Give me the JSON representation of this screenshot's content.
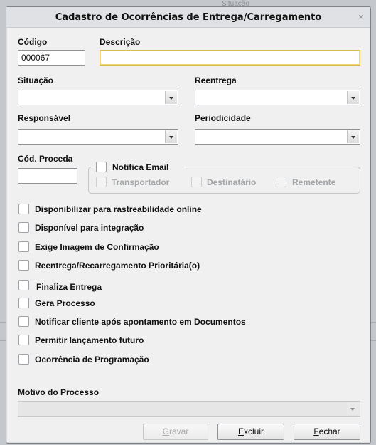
{
  "background": {
    "header_fragment": "Situação"
  },
  "dialog": {
    "title": "Cadastro de Ocorrências de Entrega/Carregamento"
  },
  "fields": {
    "codigo_label": "Código",
    "codigo_value": "000067",
    "descricao_label": "Descrição",
    "descricao_value": "",
    "situacao_label": "Situação",
    "situacao_value": "",
    "reentrega_label": "Reentrega",
    "reentrega_value": "",
    "responsavel_label": "Responsável",
    "responsavel_value": "",
    "periodicidade_label": "Periodicidade",
    "periodicidade_value": "",
    "cod_proceda_label": "Cód. Proceda",
    "cod_proceda_value": "",
    "motivo_label": "Motivo do Processo",
    "motivo_value": ""
  },
  "notifica": {
    "label": "Notifica Email",
    "options": [
      "Transportador",
      "Destinatário",
      "Remetente"
    ]
  },
  "checkboxes": [
    "Disponibilizar para rastreabilidade online",
    "Disponível para integração",
    "Exige Imagem de Confirmação",
    "Reentrega/Recarregamento Prioritária(o)",
    "Finaliza Entrega",
    "Gera Processo",
    "Notificar cliente após apontamento em Documentos",
    "Permitir lançamento futuro",
    "Ocorrência de Programação"
  ],
  "buttons": {
    "gravar": {
      "key": "G",
      "rest": "ravar"
    },
    "excluir": {
      "key": "E",
      "rest": "xcluir"
    },
    "fechar": {
      "key": "F",
      "rest": "echar"
    }
  }
}
